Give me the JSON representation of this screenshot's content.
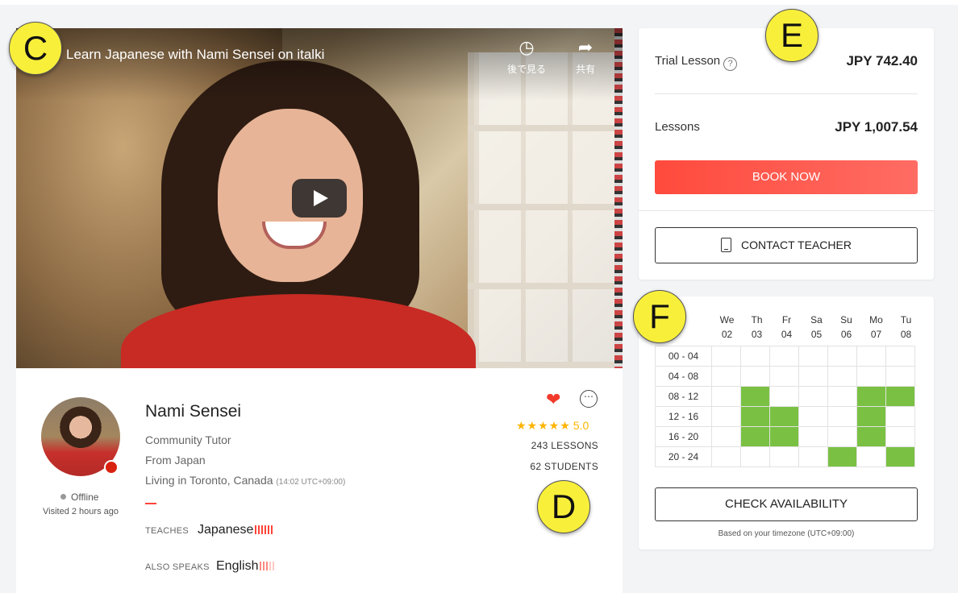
{
  "video": {
    "title": "Learn Japanese with Nami Sensei on italki",
    "watch_later_label": "後で見る",
    "share_label": "共有"
  },
  "teacher": {
    "name": "Nami Sensei",
    "role": "Community Tutor",
    "from": "From Japan",
    "living": "Living in Toronto, Canada",
    "local_time": "(14:02 UTC+09:00)",
    "status": "Offline",
    "visited": "Visited 2 hours ago",
    "teaches_label": "TEACHES",
    "teaches_lang": "Japanese",
    "also_speaks_label": "ALSO SPEAKS",
    "also_speaks_lang": "English",
    "rating": "5.0",
    "lessons": "243 LESSONS",
    "students": "62 STUDENTS"
  },
  "pricing": {
    "trial_label": "Trial Lesson",
    "trial_price": "JPY 742.40",
    "lessons_label": "Lessons",
    "lessons_price": "JPY 1,007.54",
    "book_label": "BOOK NOW",
    "contact_label": "CONTACT TEACHER"
  },
  "availability": {
    "days": [
      {
        "dow": "We",
        "date": "02"
      },
      {
        "dow": "Th",
        "date": "03"
      },
      {
        "dow": "Fr",
        "date": "04"
      },
      {
        "dow": "Sa",
        "date": "05"
      },
      {
        "dow": "Su",
        "date": "06"
      },
      {
        "dow": "Mo",
        "date": "07"
      },
      {
        "dow": "Tu",
        "date": "08"
      }
    ],
    "slots": [
      {
        "time": "00 - 04",
        "available": [
          0,
          0,
          0,
          0,
          0,
          0,
          0
        ]
      },
      {
        "time": "04 - 08",
        "available": [
          0,
          0,
          0,
          0,
          0,
          0,
          0
        ]
      },
      {
        "time": "08 - 12",
        "available": [
          0,
          1,
          0,
          0,
          0,
          1,
          1
        ]
      },
      {
        "time": "12 - 16",
        "available": [
          0,
          1,
          1,
          0,
          0,
          1,
          0
        ]
      },
      {
        "time": "16 - 20",
        "available": [
          0,
          1,
          1,
          0,
          0,
          1,
          0
        ]
      },
      {
        "time": "20 - 24",
        "available": [
          0,
          0,
          0,
          0,
          1,
          0,
          1
        ]
      }
    ],
    "available_color": "#7ac143",
    "check_label": "CHECK AVAILABILITY",
    "timezone_note": "Based on your timezone (UTC+09:00)"
  },
  "callouts": {
    "c": "C",
    "d": "D",
    "e": "E",
    "f": "F"
  },
  "colors": {
    "accent": "#ff4a3d",
    "star": "#ffb400",
    "badge": "#f8ef3a"
  }
}
